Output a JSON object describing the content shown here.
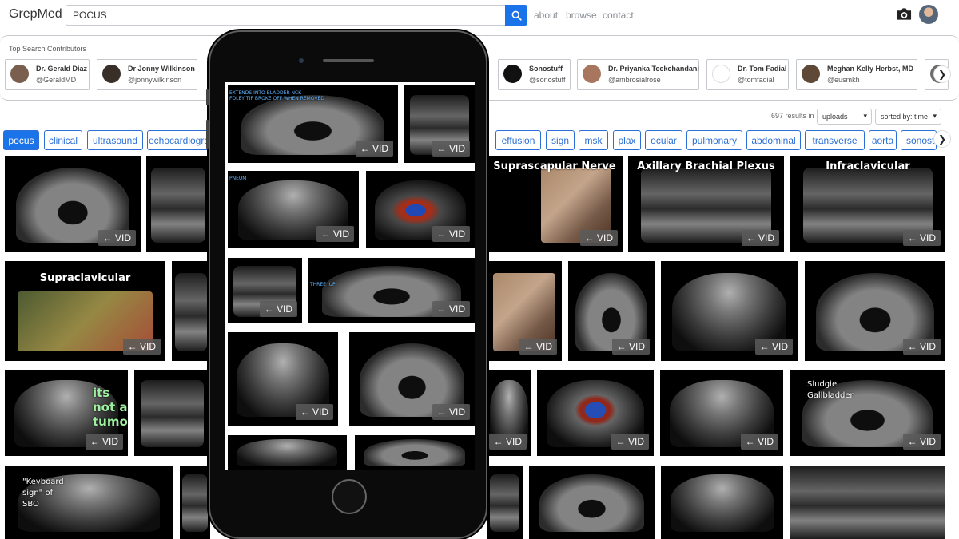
{
  "brand": "GrepMed",
  "search": {
    "value": "POCUS"
  },
  "nav": [
    "about",
    "browse",
    "contact"
  ],
  "contributors": {
    "title": "Top Search Contributors",
    "items": [
      {
        "name": "Dr. Gerald Diaz",
        "handle": "@GeraldMD"
      },
      {
        "name": "Dr Jonny Wilkinson",
        "handle": "@jonnywilkinson"
      },
      {
        "name": "Sonostuff",
        "handle": "@sonostuff"
      },
      {
        "name": "Dr. Priyanka Teckchandani",
        "handle": "@ambrosialrose"
      },
      {
        "name": "Dr. Tom Fadial",
        "handle": "@tomfadial"
      },
      {
        "name": "Meghan Kelly Herbst, MD",
        "handle": "@eusmkh"
      }
    ]
  },
  "results": {
    "count_text": "697 results in",
    "filter": "uploads",
    "sort": "sorted by: time"
  },
  "tags": [
    "pocus",
    "clinical",
    "ultrasound",
    "echocardiogra",
    "effusion",
    "sign",
    "msk",
    "plax",
    "ocular",
    "pulmonary",
    "abdominal",
    "transverse",
    "aorta",
    "sonost"
  ],
  "vid_label": "← VID",
  "tile_captions": {
    "suprascapular": "Suprascapular Nerve",
    "axillary": "Axillary Brachial Plexus",
    "infraclavicular": "Infraclavicular",
    "supraclavicular": "Supraclavicular",
    "tumor": "its\nnot a\ntumor",
    "sludgie": "Sludgie\nGallbladder",
    "keyboard": "\"Keyboard\nsign\" of\nSBO"
  },
  "phone_captions": {
    "bladder": "EXTENDS INTO BLADDER NCK\nFOLEY TIP BROKE OFF WHEN REMOVED",
    "pneum": "PNEUM",
    "three": "THREE IUP"
  }
}
